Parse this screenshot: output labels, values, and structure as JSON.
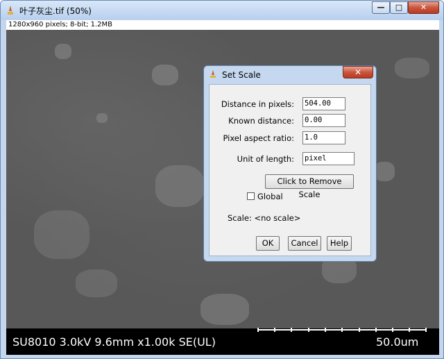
{
  "window": {
    "title": "叶子灰尘.tif (50%)",
    "minimize_glyph": "—",
    "maximize_glyph": "□",
    "close_glyph": "✕"
  },
  "image_info": "1280x960 pixels; 8-bit; 1.2MB",
  "sem_image": {
    "label": "SU8010 3.0kV 9.6mm x1.00k SE(UL)",
    "scalebar_value": "50.0um"
  },
  "dialog": {
    "title": "Set Scale",
    "close_glyph": "✕",
    "distance_label": "Distance in pixels:",
    "distance_value": "504.00",
    "known_label": "Known distance:",
    "known_value": "0.00",
    "aspect_label": "Pixel aspect ratio:",
    "aspect_value": "1.0",
    "unit_label": "Unit of length:",
    "unit_value": "pixel",
    "remove_scale_button": "Click to Remove Scale",
    "global_label": "Global",
    "global_checked": false,
    "scale_status": "Scale: <no scale>",
    "ok_button": "OK",
    "cancel_button": "Cancel",
    "help_button": "Help"
  },
  "colors": {
    "titlebar": "#c3d6ee",
    "close_button": "#c9563d",
    "sem_background": "#585858"
  }
}
